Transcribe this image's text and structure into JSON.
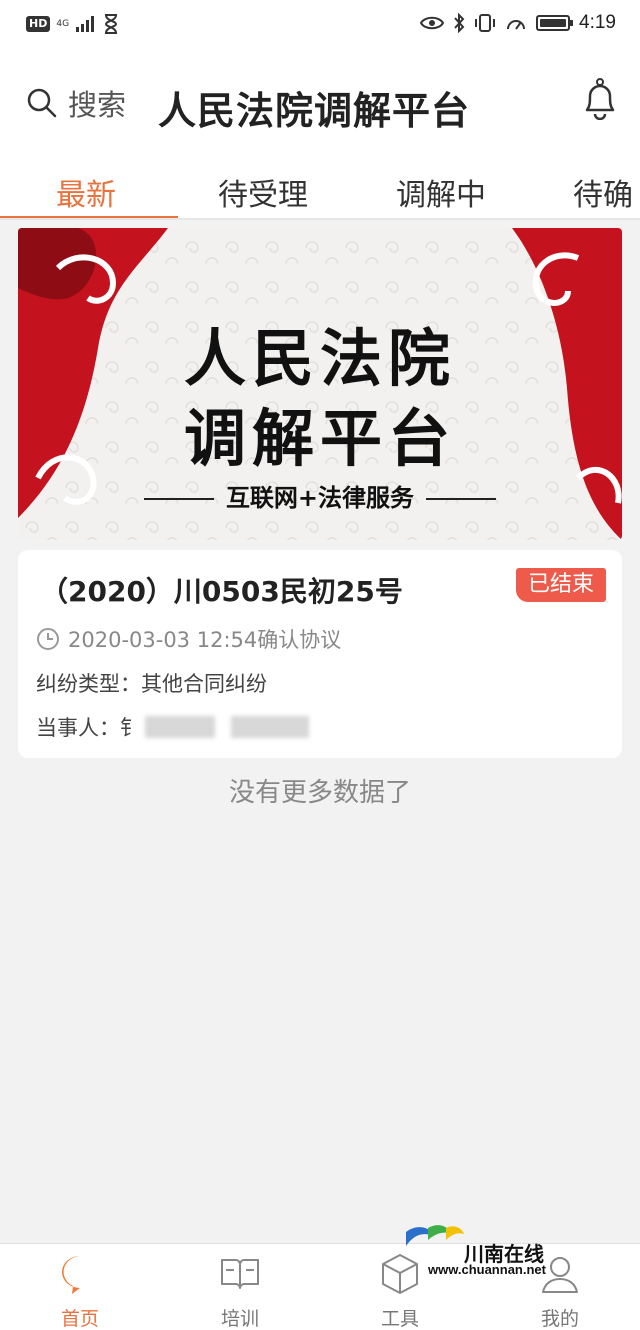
{
  "status_bar": {
    "hd": "HD",
    "network": "4G",
    "time": "4:19"
  },
  "header": {
    "search_label": "搜索",
    "title": "人民法院调解平台"
  },
  "tabs": [
    {
      "label": "最新",
      "active": true
    },
    {
      "label": "待受理",
      "active": false
    },
    {
      "label": "调解中",
      "active": false
    },
    {
      "label": "待确",
      "active": false
    }
  ],
  "banner": {
    "line1": "人民法院",
    "line2": "调解平台",
    "subtitle": "互联网+法律服务",
    "accent_color": "#c4121e"
  },
  "case": {
    "title": "（2020）川0503民初25号",
    "status": "已结束",
    "time": "2020-03-03 12:54确认协议",
    "type_label": "纠纷类型：",
    "type_value": "其他合同纠纷",
    "party_label": "当事人：",
    "party_value_visible": "钅"
  },
  "list_footer": "没有更多数据了",
  "bottom_nav": [
    {
      "label": "首页",
      "icon": "chat-bubble-icon",
      "active": true
    },
    {
      "label": "培训",
      "icon": "book-icon",
      "active": false
    },
    {
      "label": "工具",
      "icon": "box-icon",
      "active": false
    },
    {
      "label": "我的",
      "icon": "person-icon",
      "active": false
    }
  ],
  "watermark": {
    "name": "川南在线",
    "url": "www.chuannan.net"
  },
  "colors": {
    "accent": "#e8733f",
    "status_tag": "#ef5b4b",
    "background": "#f2f2f2"
  }
}
